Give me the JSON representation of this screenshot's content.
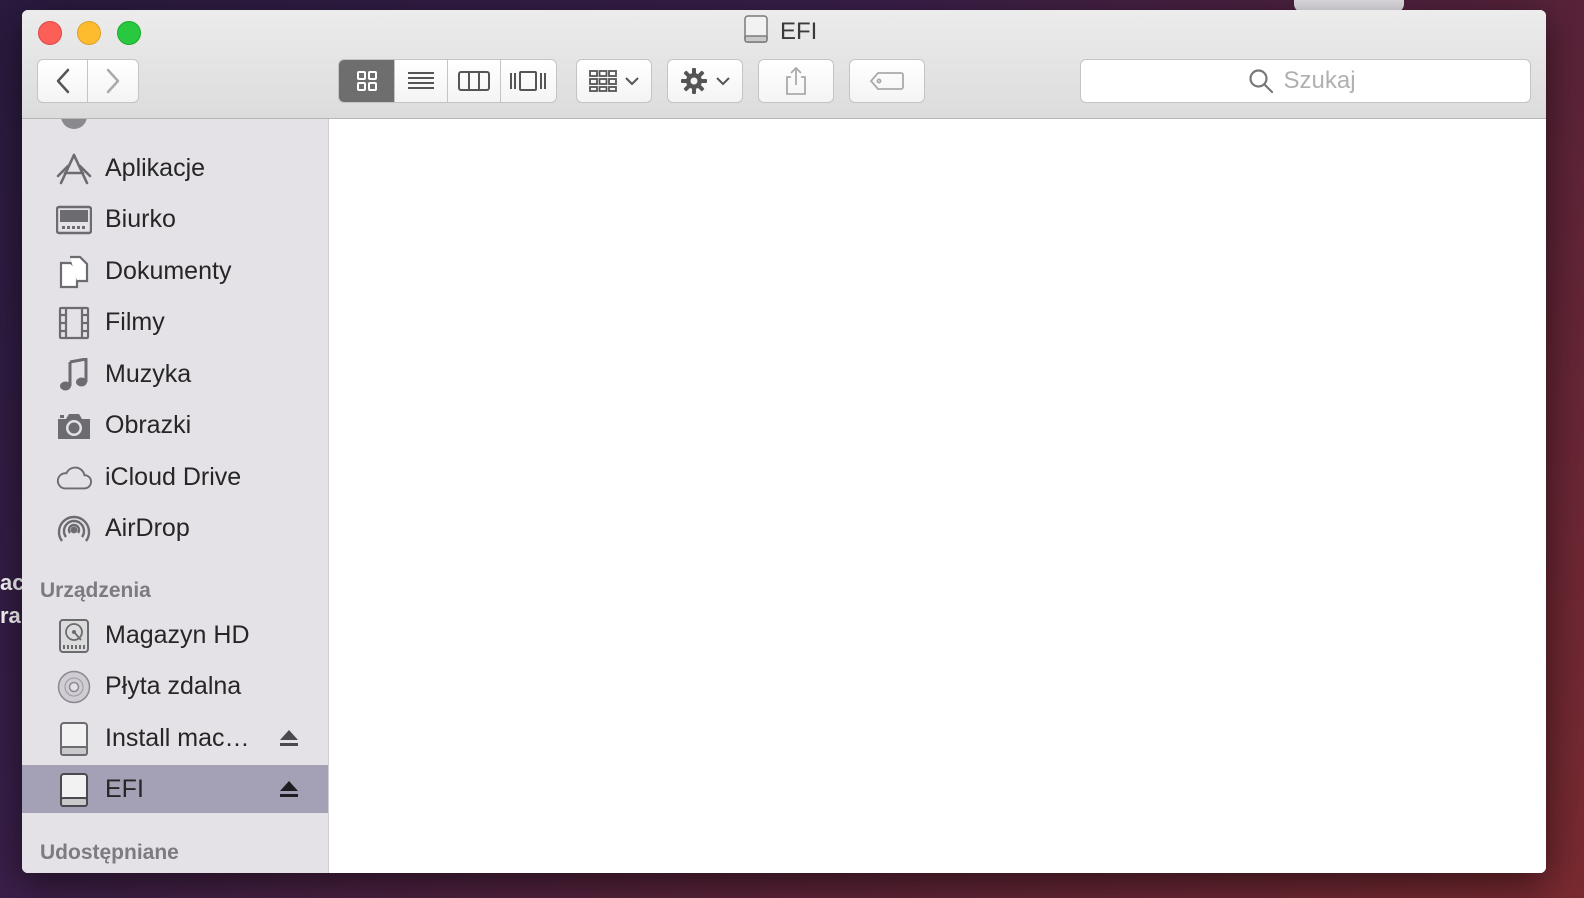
{
  "window": {
    "title": "EFI"
  },
  "search": {
    "placeholder": "Szukaj"
  },
  "desktop": {
    "label_1": "ac",
    "label_2": "ra"
  },
  "sidebar": {
    "favorites": [
      {
        "label": "Aplikacje",
        "icon": "applications-icon"
      },
      {
        "label": "Biurko",
        "icon": "desktop-icon"
      },
      {
        "label": "Dokumenty",
        "icon": "documents-icon"
      },
      {
        "label": "Filmy",
        "icon": "movies-icon"
      },
      {
        "label": "Muzyka",
        "icon": "music-icon"
      },
      {
        "label": "Obrazki",
        "icon": "camera-icon"
      },
      {
        "label": "iCloud Drive",
        "icon": "cloud-icon"
      },
      {
        "label": "AirDrop",
        "icon": "airdrop-icon"
      }
    ],
    "devices_header": "Urządzenia",
    "devices": [
      {
        "label": "Magazyn HD",
        "icon": "hard-drive-icon",
        "ejectable": false
      },
      {
        "label": "Płyta zdalna",
        "icon": "optical-disc-icon",
        "ejectable": false
      },
      {
        "label": "Install mac…",
        "icon": "external-drive-icon",
        "ejectable": true
      },
      {
        "label": "EFI",
        "icon": "external-drive-icon",
        "ejectable": true,
        "selected": true
      }
    ],
    "shared_header": "Udostępniane"
  },
  "colors": {
    "selection": "#a4a0b5",
    "sidebar_bg": "#e4e1e7",
    "close": "#fc5f57",
    "minimize": "#fdbc2e",
    "zoom": "#28c840"
  }
}
